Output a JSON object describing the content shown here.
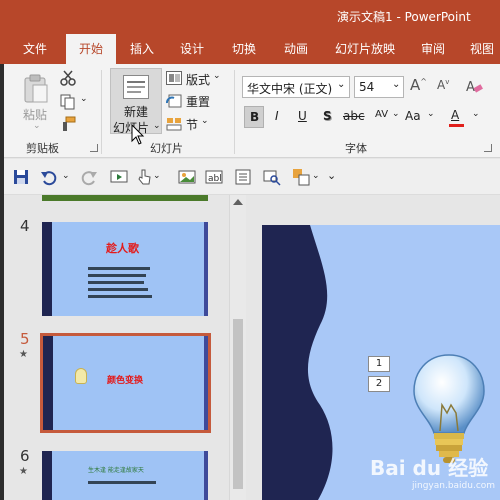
{
  "window": {
    "title": "演示文稿1  -  PowerPoint"
  },
  "tabs": [
    "文件",
    "开始",
    "插入",
    "设计",
    "切换",
    "动画",
    "幻灯片放映",
    "审阅",
    "视图"
  ],
  "active_tab": "开始",
  "clipboard": {
    "paste_label": "粘贴",
    "group_label": "剪贴板"
  },
  "slides_group": {
    "new_slide_line1": "新建",
    "new_slide_line2": "幻灯片",
    "layout_label": "版式",
    "reset_label": "重置",
    "section_label": "节",
    "group_label": "幻灯片"
  },
  "font_group": {
    "font_name": "华文中宋 (正文)",
    "font_size": "54",
    "bold": "B",
    "italic": "I",
    "underline": "U",
    "shadow": "S",
    "strikethrough": "abc",
    "spacing": "AV",
    "change_case": "Aa",
    "font_color": "A",
    "group_label": "字体"
  },
  "thumbnails": [
    {
      "number": "4",
      "title": "趁人歌",
      "has_star": false
    },
    {
      "number": "5",
      "title": "颜色变换",
      "has_star": true,
      "selected": true
    },
    {
      "number": "6",
      "title": "生木逢 能走逢故家天",
      "has_star": true
    }
  ],
  "main_slide": {
    "number_boxes": [
      "1",
      "2"
    ]
  },
  "watermark": {
    "text": "Bai du 经验",
    "sub": "jingyan.baidu.com"
  },
  "colors": {
    "accent": "#b7472a",
    "slide_bg": "#a9c8f7",
    "slide_dark": "#1f2551",
    "selected_border": "#c55a3c"
  }
}
